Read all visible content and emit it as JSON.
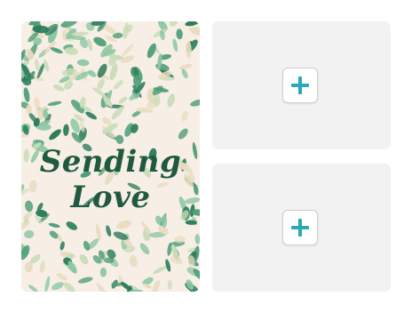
{
  "card": {
    "line1": "Sending",
    "line2": "Love",
    "text_color": "#1f5a3f",
    "background_color": "#f7eee6",
    "leaf_colors": [
      "#2e7d5b",
      "#4f9e78",
      "#8cc7a4",
      "#c9ddb8",
      "#e8dcc0"
    ]
  },
  "slots": [
    {
      "icon": "plus-icon"
    },
    {
      "icon": "plus-icon"
    }
  ],
  "accent_color": "#2ba7b5"
}
